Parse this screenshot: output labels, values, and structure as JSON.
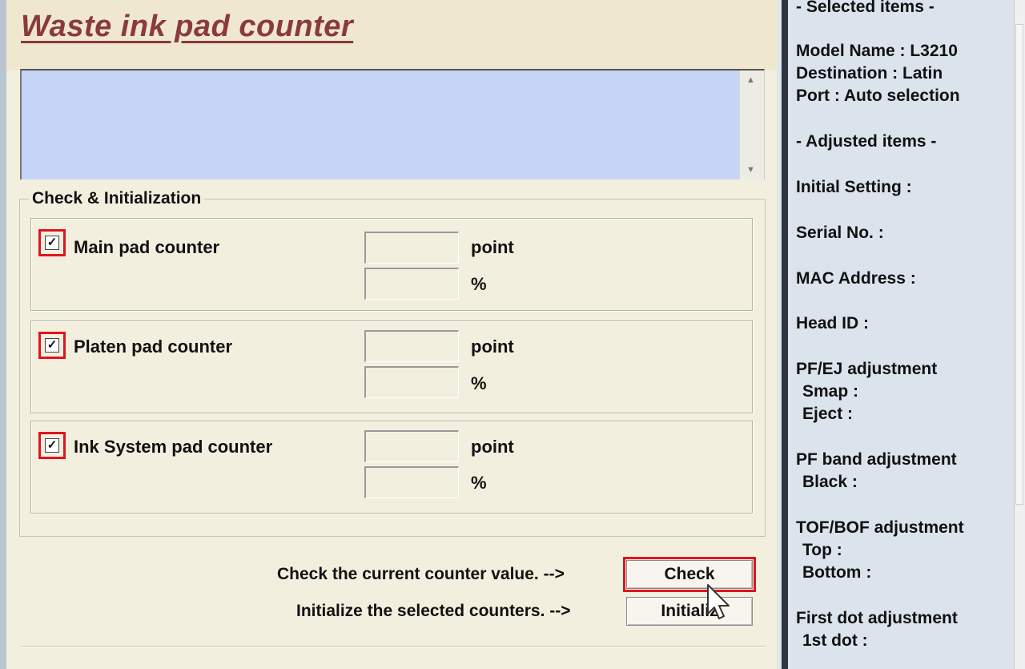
{
  "page": {
    "title": "Waste ink pad counter"
  },
  "group": {
    "label": "Check & Initialization"
  },
  "counters": [
    {
      "label": "Main pad counter",
      "checked": true,
      "point_value": "",
      "percent_value": "",
      "point_unit": "point",
      "percent_unit": "%"
    },
    {
      "label": "Platen pad counter",
      "checked": true,
      "point_value": "",
      "percent_value": "",
      "point_unit": "point",
      "percent_unit": "%"
    },
    {
      "label": "Ink System pad counter",
      "checked": true,
      "point_value": "",
      "percent_value": "",
      "point_unit": "point",
      "percent_unit": "%"
    }
  ],
  "actions": {
    "check_hint": "Check the current counter value. -->",
    "check_label": "Check",
    "init_hint": "Initialize the selected counters. -->",
    "init_label": "Initializ"
  },
  "side": {
    "selected_header": "- Selected items -",
    "model": "Model Name : L3210",
    "destination": "Destination : Latin",
    "port": "Port : Auto selection",
    "adjusted_header": "- Adjusted items -",
    "initial_setting": "Initial Setting :",
    "serial": "Serial No. :",
    "mac": "MAC Address :",
    "head_id": "Head ID :",
    "pfej": "PF/EJ adjustment",
    "smap": "Smap :",
    "eject": "Eject :",
    "pfband": "PF band adjustment",
    "black": "Black :",
    "tofbof": "TOF/BOF adjustment",
    "top": "Top :",
    "bottom": "Bottom :",
    "firstdot": "First dot adjustment",
    "firstdot_val": "1st dot :"
  },
  "colors": {
    "highlight": "#e0141d",
    "title": "#8b3a3a",
    "log_bg": "#c4d5f8",
    "panel_bg": "#f3efdf"
  }
}
